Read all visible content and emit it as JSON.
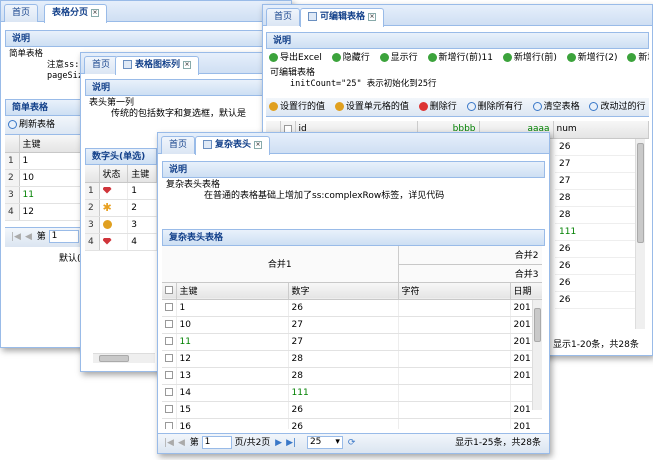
{
  "w1": {
    "tabs": [
      "首页",
      "表格分页"
    ],
    "desc_header": "说明",
    "desc_lines": [
      "简单表格",
      "注意ss:",
      "pageSiz"
    ],
    "grid_header": "简单表格",
    "refresh": "刷新表格",
    "col_key": "主键",
    "rows": [
      [
        "1",
        "1"
      ],
      [
        "2",
        "10"
      ],
      [
        "3",
        "11"
      ],
      [
        "4",
        "12"
      ]
    ],
    "pager_page_label": "第",
    "page_value": "1",
    "bottom_text": "默认("
  },
  "w2": {
    "tabs": [
      "首页",
      "表格图标列"
    ],
    "desc_header": "说明",
    "desc_lines": [
      "表头第一列",
      "传统的包括数字和复选框，默认是"
    ],
    "grid_header": "数字头(单选)",
    "col_status": "状态",
    "col_key": "主键",
    "rows": [
      {
        "rn": "1",
        "icon": "red-gem-icon",
        "key": "1"
      },
      {
        "rn": "2",
        "icon": "gear-star-icon",
        "key": "2"
      },
      {
        "rn": "3",
        "icon": "medal-icon",
        "key": "3"
      },
      {
        "rn": "4",
        "icon": "red-gem-icon",
        "key": "4"
      }
    ]
  },
  "w3": {
    "tabs": [
      "首页",
      "可编辑表格"
    ],
    "desc_header": "说明",
    "toolbar1": [
      "导出Excel",
      "隐藏行",
      "显示行",
      "新增行(前)11",
      "新增行(前)",
      "新增行(2)",
      "新增行(前)"
    ],
    "desc_lines": [
      "可编辑表格",
      "initCount=\"25\" 表示初始化到25行"
    ],
    "toolbar2": [
      "设置行的值",
      "设置单元格的值",
      "删除行",
      "删除所有行",
      "清空表格",
      "改动过的行"
    ],
    "cols": [
      "id",
      "bbbb",
      "aaaa",
      "num"
    ],
    "num_values": [
      "26",
      "27",
      "27",
      "28",
      "28",
      "111",
      "26",
      "26",
      "26",
      "26"
    ],
    "pager_info": "显示1-20条，共28条"
  },
  "w4": {
    "tabs": [
      "首页",
      "复杂表头"
    ],
    "desc_header": "说明",
    "desc_lines": [
      "复杂表头表格",
      "在普通的表格基础上增加了ss:complexRow标签，详见代码"
    ],
    "grid_header": "复杂表头表格",
    "merge1": "合并1",
    "merge2": "合并2",
    "merge3": "合并3",
    "cols": [
      "主键",
      "数字",
      "字符",
      "日期"
    ],
    "rows": [
      [
        "1",
        "26",
        "",
        "201"
      ],
      [
        "10",
        "27",
        "",
        "201"
      ],
      [
        "11",
        "27",
        "",
        "201"
      ],
      [
        "12",
        "28",
        "",
        "201"
      ],
      [
        "13",
        "28",
        "",
        "201"
      ],
      [
        "14",
        "111",
        "",
        ""
      ],
      [
        "15",
        "26",
        "",
        "201"
      ],
      [
        "16",
        "26",
        "",
        "201"
      ]
    ],
    "pager_page_label": "第",
    "page_value": "1",
    "page_total": "页/共2页",
    "page_size": "25",
    "pager_info": "显示1-25条，共28条"
  }
}
